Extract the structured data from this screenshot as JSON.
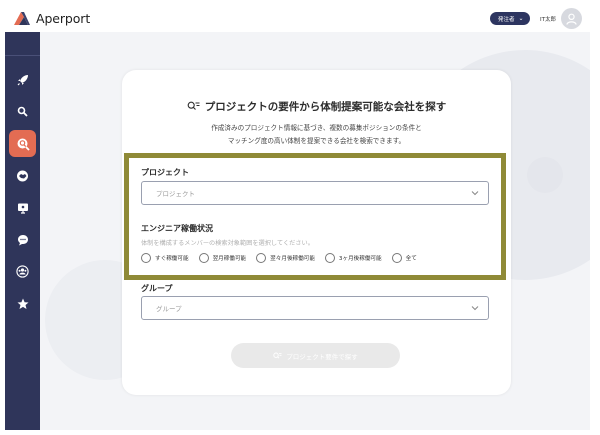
{
  "header": {
    "logo_text": "Aperport",
    "role_label": "発注者",
    "user_name": "IT太郎"
  },
  "sidebar": {
    "items": [
      {
        "icon": "rocket-icon",
        "active": false
      },
      {
        "icon": "search-icon",
        "active": false
      },
      {
        "icon": "company-search-icon",
        "active": true
      },
      {
        "icon": "handshake-icon",
        "active": false
      },
      {
        "icon": "monitor-icon",
        "active": false
      },
      {
        "icon": "chat-icon",
        "active": false
      },
      {
        "icon": "team-icon",
        "active": false
      },
      {
        "icon": "star-icon",
        "active": false
      }
    ]
  },
  "card": {
    "title": "プロジェクトの要件から体制提案可能な会社を探す",
    "description_line1": "作成済みのプロジェクト情報に基づき、複数の募集ポジションの条件と",
    "description_line2": "マッチング度の高い体制を提案できる会社を検索できます。",
    "project": {
      "label": "プロジェクト",
      "placeholder": "プロジェクト"
    },
    "engineer_status": {
      "label": "エンジニア稼働状況",
      "help": "体制を構成するメンバーの検索対象範囲を選択してください。",
      "options": [
        "すぐ稼働可能",
        "翌月稼働可能",
        "翌々月後稼働可能",
        "3ヶ月後稼働可能",
        "全て"
      ]
    },
    "group": {
      "label": "グループ",
      "placeholder": "グループ"
    },
    "search_button": "プロジェクト要件で探す"
  },
  "colors": {
    "sidebar_bg": "#2f355a",
    "active_item": "#e36c53",
    "highlight_border": "#8f8a37",
    "role_pill": "#2d3560"
  }
}
